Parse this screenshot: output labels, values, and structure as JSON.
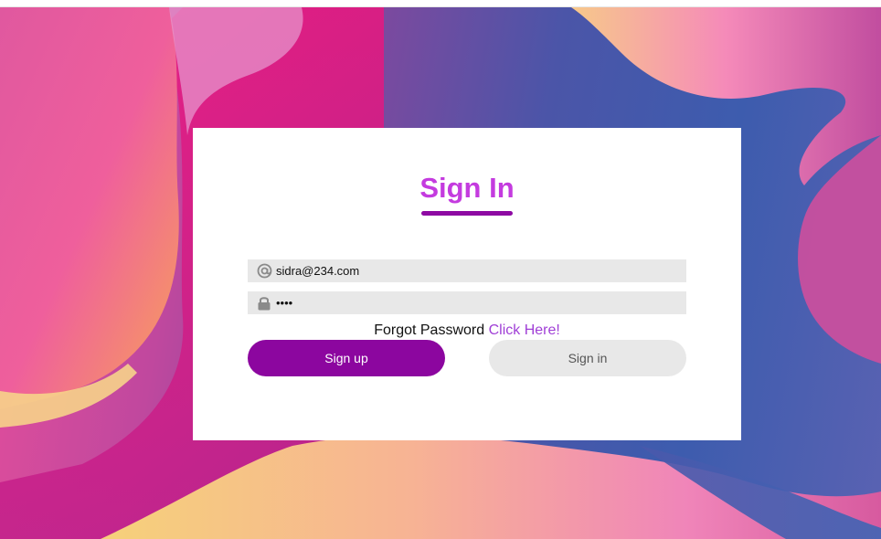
{
  "colors": {
    "accent": "#c43bdf",
    "primary_button": "#8c069f",
    "link": "#a03fd6",
    "input_background": "#e8e8e8"
  },
  "form": {
    "title": "Sign In",
    "email": {
      "value": "sidra@234.com",
      "icon": "at-icon"
    },
    "password": {
      "value": "••••",
      "icon": "lock-icon"
    },
    "forgot_text": "Forgot Password",
    "forgot_link": "Click Here!",
    "signup_label": "Sign up",
    "signin_label": "Sign in"
  }
}
